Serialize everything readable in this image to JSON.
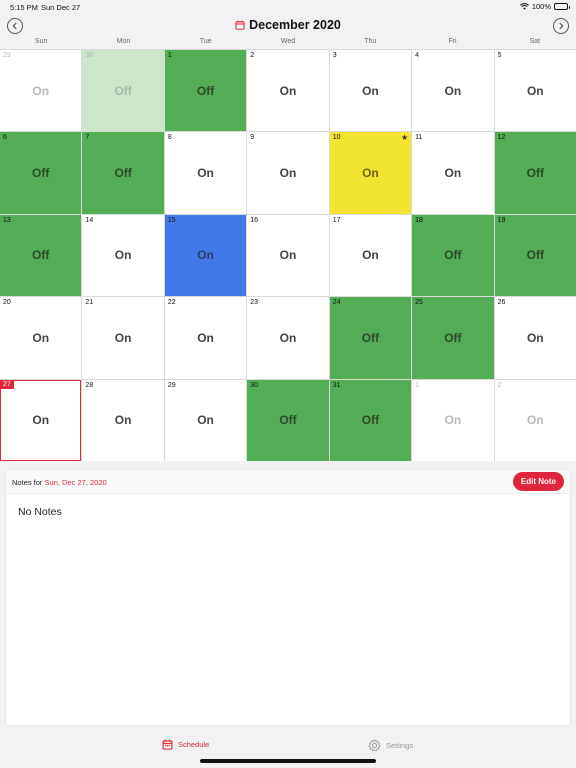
{
  "status": {
    "time": "5:15 PM",
    "date": "Sun Dec 27",
    "battery": "100%"
  },
  "header": {
    "title": "December 2020"
  },
  "weekdays": [
    "Sun",
    "Mon",
    "Tue",
    "Wed",
    "Thu",
    "Fri",
    "Sat"
  ],
  "days": [
    {
      "n": "29",
      "s": "On",
      "t": "outside"
    },
    {
      "n": "30",
      "s": "Off",
      "t": "outside-off"
    },
    {
      "n": "1",
      "s": "Off",
      "t": "off"
    },
    {
      "n": "2",
      "s": "On",
      "t": ""
    },
    {
      "n": "3",
      "s": "On",
      "t": ""
    },
    {
      "n": "4",
      "s": "On",
      "t": ""
    },
    {
      "n": "5",
      "s": "On",
      "t": ""
    },
    {
      "n": "6",
      "s": "Off",
      "t": "off"
    },
    {
      "n": "7",
      "s": "Off",
      "t": "off"
    },
    {
      "n": "8",
      "s": "On",
      "t": ""
    },
    {
      "n": "9",
      "s": "On",
      "t": ""
    },
    {
      "n": "10",
      "s": "On",
      "t": "yellow",
      "star": "★"
    },
    {
      "n": "11",
      "s": "On",
      "t": ""
    },
    {
      "n": "12",
      "s": "Off",
      "t": "off"
    },
    {
      "n": "13",
      "s": "Off",
      "t": "off"
    },
    {
      "n": "14",
      "s": "On",
      "t": ""
    },
    {
      "n": "15",
      "s": "On",
      "t": "blue"
    },
    {
      "n": "16",
      "s": "On",
      "t": ""
    },
    {
      "n": "17",
      "s": "On",
      "t": ""
    },
    {
      "n": "18",
      "s": "Off",
      "t": "off"
    },
    {
      "n": "19",
      "s": "Off",
      "t": "off"
    },
    {
      "n": "20",
      "s": "On",
      "t": ""
    },
    {
      "n": "21",
      "s": "On",
      "t": ""
    },
    {
      "n": "22",
      "s": "On",
      "t": ""
    },
    {
      "n": "23",
      "s": "On",
      "t": ""
    },
    {
      "n": "24",
      "s": "Off",
      "t": "off"
    },
    {
      "n": "25",
      "s": "Off",
      "t": "off"
    },
    {
      "n": "26",
      "s": "On",
      "t": ""
    },
    {
      "n": "27",
      "s": "On",
      "t": "today"
    },
    {
      "n": "28",
      "s": "On",
      "t": ""
    },
    {
      "n": "29",
      "s": "On",
      "t": ""
    },
    {
      "n": "30",
      "s": "Off",
      "t": "off"
    },
    {
      "n": "31",
      "s": "Off",
      "t": "off"
    },
    {
      "n": "1",
      "s": "On",
      "t": "outside"
    },
    {
      "n": "2",
      "s": "On",
      "t": "outside"
    }
  ],
  "notes": {
    "prefix": "Notes for",
    "date": "Sun, Dec 27, 2020",
    "edit_label": "Edit Note",
    "empty_text": "No Notes"
  },
  "tabs": {
    "schedule": "Schedule",
    "settings": "Settings"
  },
  "colors": {
    "accent": "#e0263a",
    "off_green": "#52ad54",
    "blue": "#4279e8",
    "yellow": "#f2e431"
  }
}
